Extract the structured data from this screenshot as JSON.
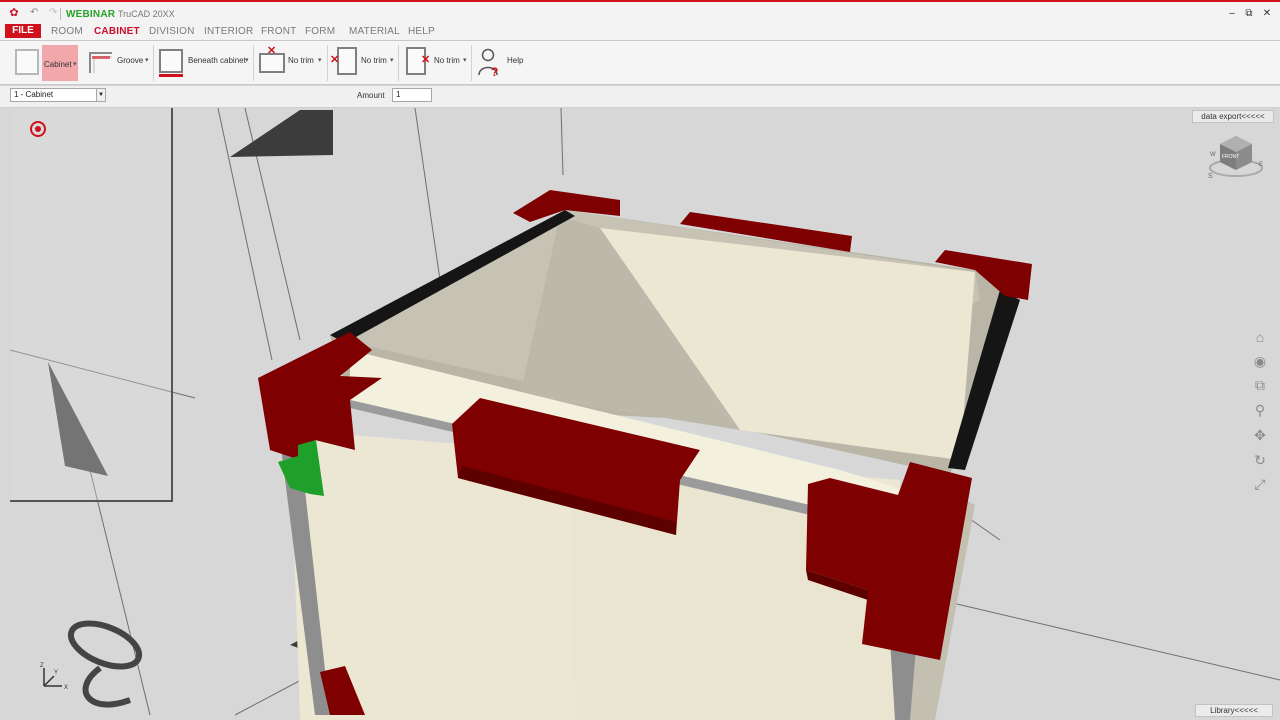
{
  "titlebar": {
    "webinar": "WEBINAR",
    "app_title": "TruCAD 20XX",
    "minimize": "‒",
    "maximize": "⧉",
    "close": "✕"
  },
  "menu": {
    "file": "FILE",
    "items": [
      "ROOM",
      "CABINET",
      "DIVISION",
      "INTERIOR",
      "FRONT",
      "FORM",
      "MATERIAL",
      "HELP"
    ],
    "active": "CABINET"
  },
  "ribbon": {
    "cabinet": "Cabinet",
    "groove": "Groove",
    "beneath_cabinet": "Beneath cabinet",
    "no_trim_1": "No trim",
    "no_trim_2": "No trim",
    "no_trim_3": "No trim",
    "help": "Help"
  },
  "options": {
    "cabinet_select": "1 - Cabinet",
    "amount_label": "Amount",
    "amount_value": "1"
  },
  "viewport": {
    "data_export": "data export<<<<<",
    "library": "Library<<<<<",
    "navcube_face": "FRONT"
  },
  "colors": {
    "brand_red": "#d0101a",
    "edge_banding": "#7e0000",
    "panel_cream": "#f3f0de",
    "active_green": "#1fa02a"
  }
}
